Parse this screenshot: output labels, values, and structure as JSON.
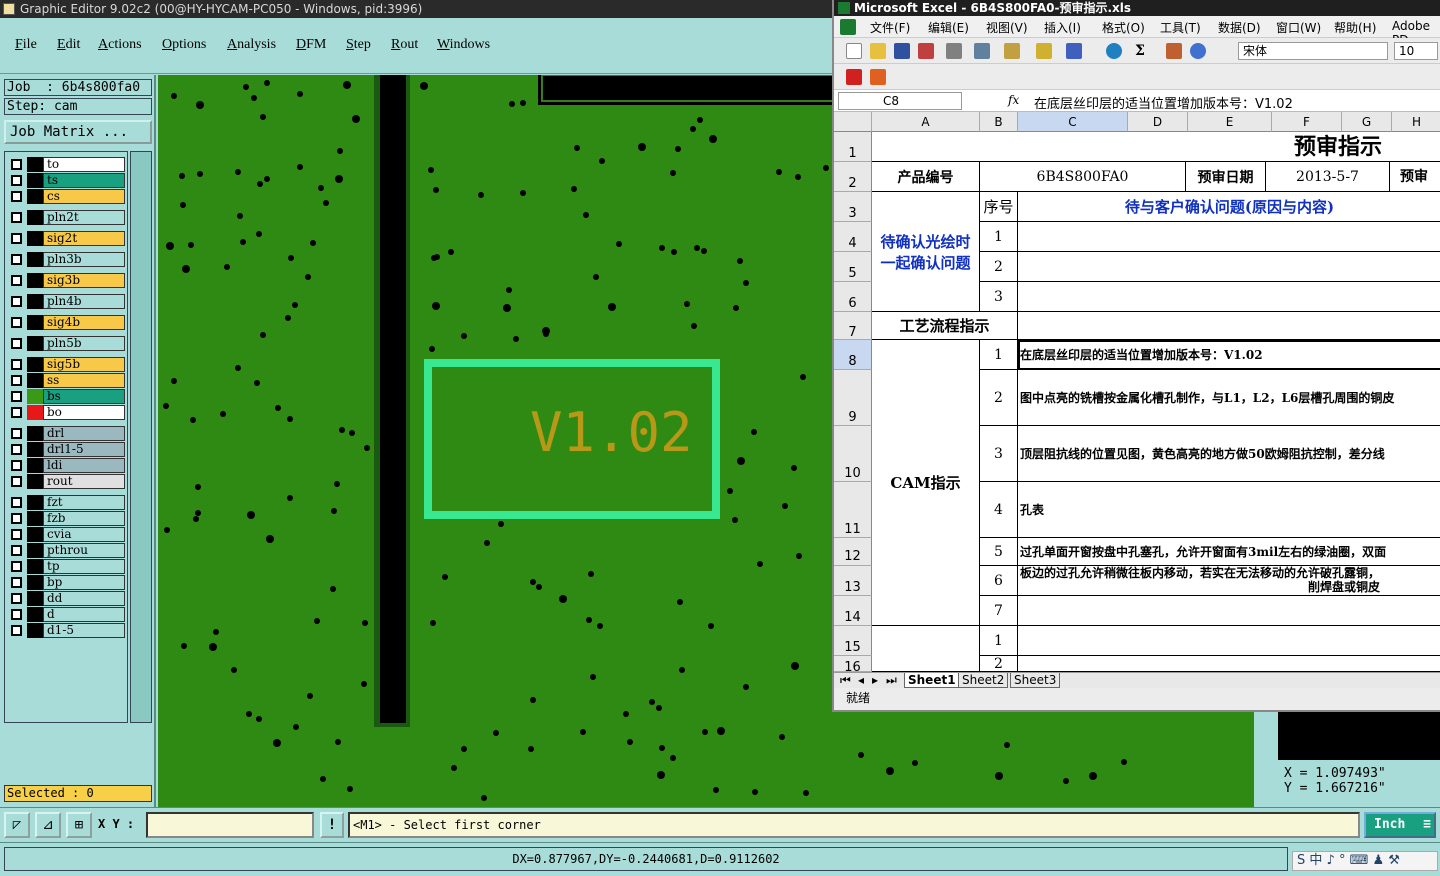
{
  "editor": {
    "title": "Graphic Editor 9.02c2 (00@HY-HYCAM-PC050 - Windows, pid:3996)",
    "menus": [
      "File",
      "Edit",
      "Actions",
      "Options",
      "Analysis",
      "DFM",
      "Step",
      "Rout",
      "Windows"
    ],
    "job": "Job  : 6b4s800fa0",
    "step": "Step: cam",
    "job_matrix": "Job Matrix ...",
    "layers": [
      {
        "name": "to",
        "color": "#ffffff",
        "swatch": "#000000"
      },
      {
        "name": "ts",
        "color": "#18a080",
        "swatch": "#000000"
      },
      {
        "name": "cs",
        "color": "#f8c848",
        "swatch": "#000000"
      },
      {
        "name": "pln2t",
        "color": "#a8dcd8",
        "swatch": "#000000"
      },
      {
        "name": "sig2t",
        "color": "#f8c848",
        "swatch": "#000000"
      },
      {
        "name": "pln3b",
        "color": "#a8dcd8",
        "swatch": "#000000"
      },
      {
        "name": "sig3b",
        "color": "#f8c848",
        "swatch": "#000000"
      },
      {
        "name": "pln4b",
        "color": "#a8dcd8",
        "swatch": "#000000"
      },
      {
        "name": "sig4b",
        "color": "#f8c848",
        "swatch": "#000000"
      },
      {
        "name": "pln5b",
        "color": "#a8dcd8",
        "swatch": "#000000"
      },
      {
        "name": "sig5b",
        "color": "#f8c848",
        "swatch": "#000000"
      },
      {
        "name": "ss",
        "color": "#f8c848",
        "swatch": "#000000"
      },
      {
        "name": "bs",
        "color": "#18a080",
        "swatch": "#3a9a18"
      },
      {
        "name": "bo",
        "color": "#ffffff",
        "swatch": "#e81818"
      },
      {
        "name": "drl",
        "color": "#9ab8c0",
        "swatch": "#000000"
      },
      {
        "name": "drl1-5",
        "color": "#9ab8c0",
        "swatch": "#000000"
      },
      {
        "name": "ldi",
        "color": "#9ab8c0",
        "swatch": "#000000"
      },
      {
        "name": "rout",
        "color": "#e0e0e0",
        "swatch": "#000000"
      },
      {
        "name": "fzt",
        "color": "#a8dcd8",
        "swatch": "#000000"
      },
      {
        "name": "fzb",
        "color": "#a8dcd8",
        "swatch": "#000000"
      },
      {
        "name": "cvia",
        "color": "#a8dcd8",
        "swatch": "#000000"
      },
      {
        "name": "pthrou",
        "color": "#a8dcd8",
        "swatch": "#000000"
      },
      {
        "name": "tp",
        "color": "#a8dcd8",
        "swatch": "#000000"
      },
      {
        "name": "bp",
        "color": "#a8dcd8",
        "swatch": "#000000"
      },
      {
        "name": "dd",
        "color": "#a8dcd8",
        "swatch": "#000000"
      },
      {
        "name": "d",
        "color": "#a8dcd8",
        "swatch": "#000000"
      },
      {
        "name": "d1-5",
        "color": "#a8dcd8",
        "swatch": "#000000"
      }
    ],
    "selected": "Selected : 0",
    "canvas_text": "V1.02",
    "coord_x": "X  =  1.097493\"",
    "coord_y": "Y  =  1.667216\"",
    "xy_label": "X Y :",
    "xy_value": "",
    "excl": "!",
    "prompt": "<M1> - Select first corner",
    "unit": "Inch",
    "dx": "DX=0.877967,DY=-0.2440681,D=0.9112602",
    "tray": "S 中 ♪ ° ⌨ ♟ ⚒"
  },
  "excel": {
    "title": "Microsoft Excel - 6B4S800FA0-预审指示.xls",
    "menus": [
      "文件(F)",
      "编辑(E)",
      "视图(V)",
      "插入(I)",
      "格式(O)",
      "工具(T)",
      "数据(D)",
      "窗口(W)",
      "帮助(H)",
      "Adobe PD"
    ],
    "font": "宋体",
    "size": "10",
    "namebox": "C8",
    "fx": "fx",
    "formula": "在底层丝印层的适当位置增加版本号：V1.02",
    "col_headers": [
      "A",
      "B",
      "C",
      "D",
      "E",
      "F",
      "G",
      "H"
    ],
    "row_headers": [
      "1",
      "2",
      "3",
      "4",
      "5",
      "6",
      "7",
      "8",
      "9",
      "10",
      "11",
      "12",
      "13",
      "14",
      "15",
      "16"
    ],
    "cells": {
      "title": "预审指示",
      "product_no_label": "产品编号",
      "product_no": "6B4S800FA0",
      "date_label": "预审日期",
      "date": "2013-5-7",
      "h2": "预审",
      "confirm_label_1": "待确认光绘时",
      "confirm_label_2": "一起确认问题",
      "seq_label": "序号",
      "issue_header": "待与客户确认问题(原因与内容)",
      "seq_1": "1",
      "seq_2": "2",
      "seq_3": "3",
      "process_label": "工艺流程指示",
      "cam_label": "CAM指示",
      "cam_rows": [
        {
          "n": "1",
          "text": "在底层丝印层的适当位置增加版本号：V1.02"
        },
        {
          "n": "2",
          "text": "图中点亮的铣槽按金属化槽孔制作，与L1，L2，L6层槽孔周围的铜皮"
        },
        {
          "n": "3",
          "text": "顶层阻抗线的位置见图，黄色高亮的地方做50欧姆阻抗控制，差分线"
        },
        {
          "n": "4",
          "text": "孔表"
        },
        {
          "n": "5",
          "text": "过孔单面开窗按盘中孔塞孔，允许开窗面有3mil左右的绿油圈，双面"
        },
        {
          "n": "6",
          "text": "板边的过孔允许稍微往板内移动，若实在无法移动的允许破孔露铜，"
        },
        {
          "n": "7",
          "text": ""
        }
      ],
      "cam_row6_line2": "削焊盘或铜皮",
      "row15_seq": "1",
      "row16_seq": "2"
    },
    "sheets": [
      "Sheet1",
      "Sheet2",
      "Sheet3"
    ],
    "status": "就绪"
  }
}
